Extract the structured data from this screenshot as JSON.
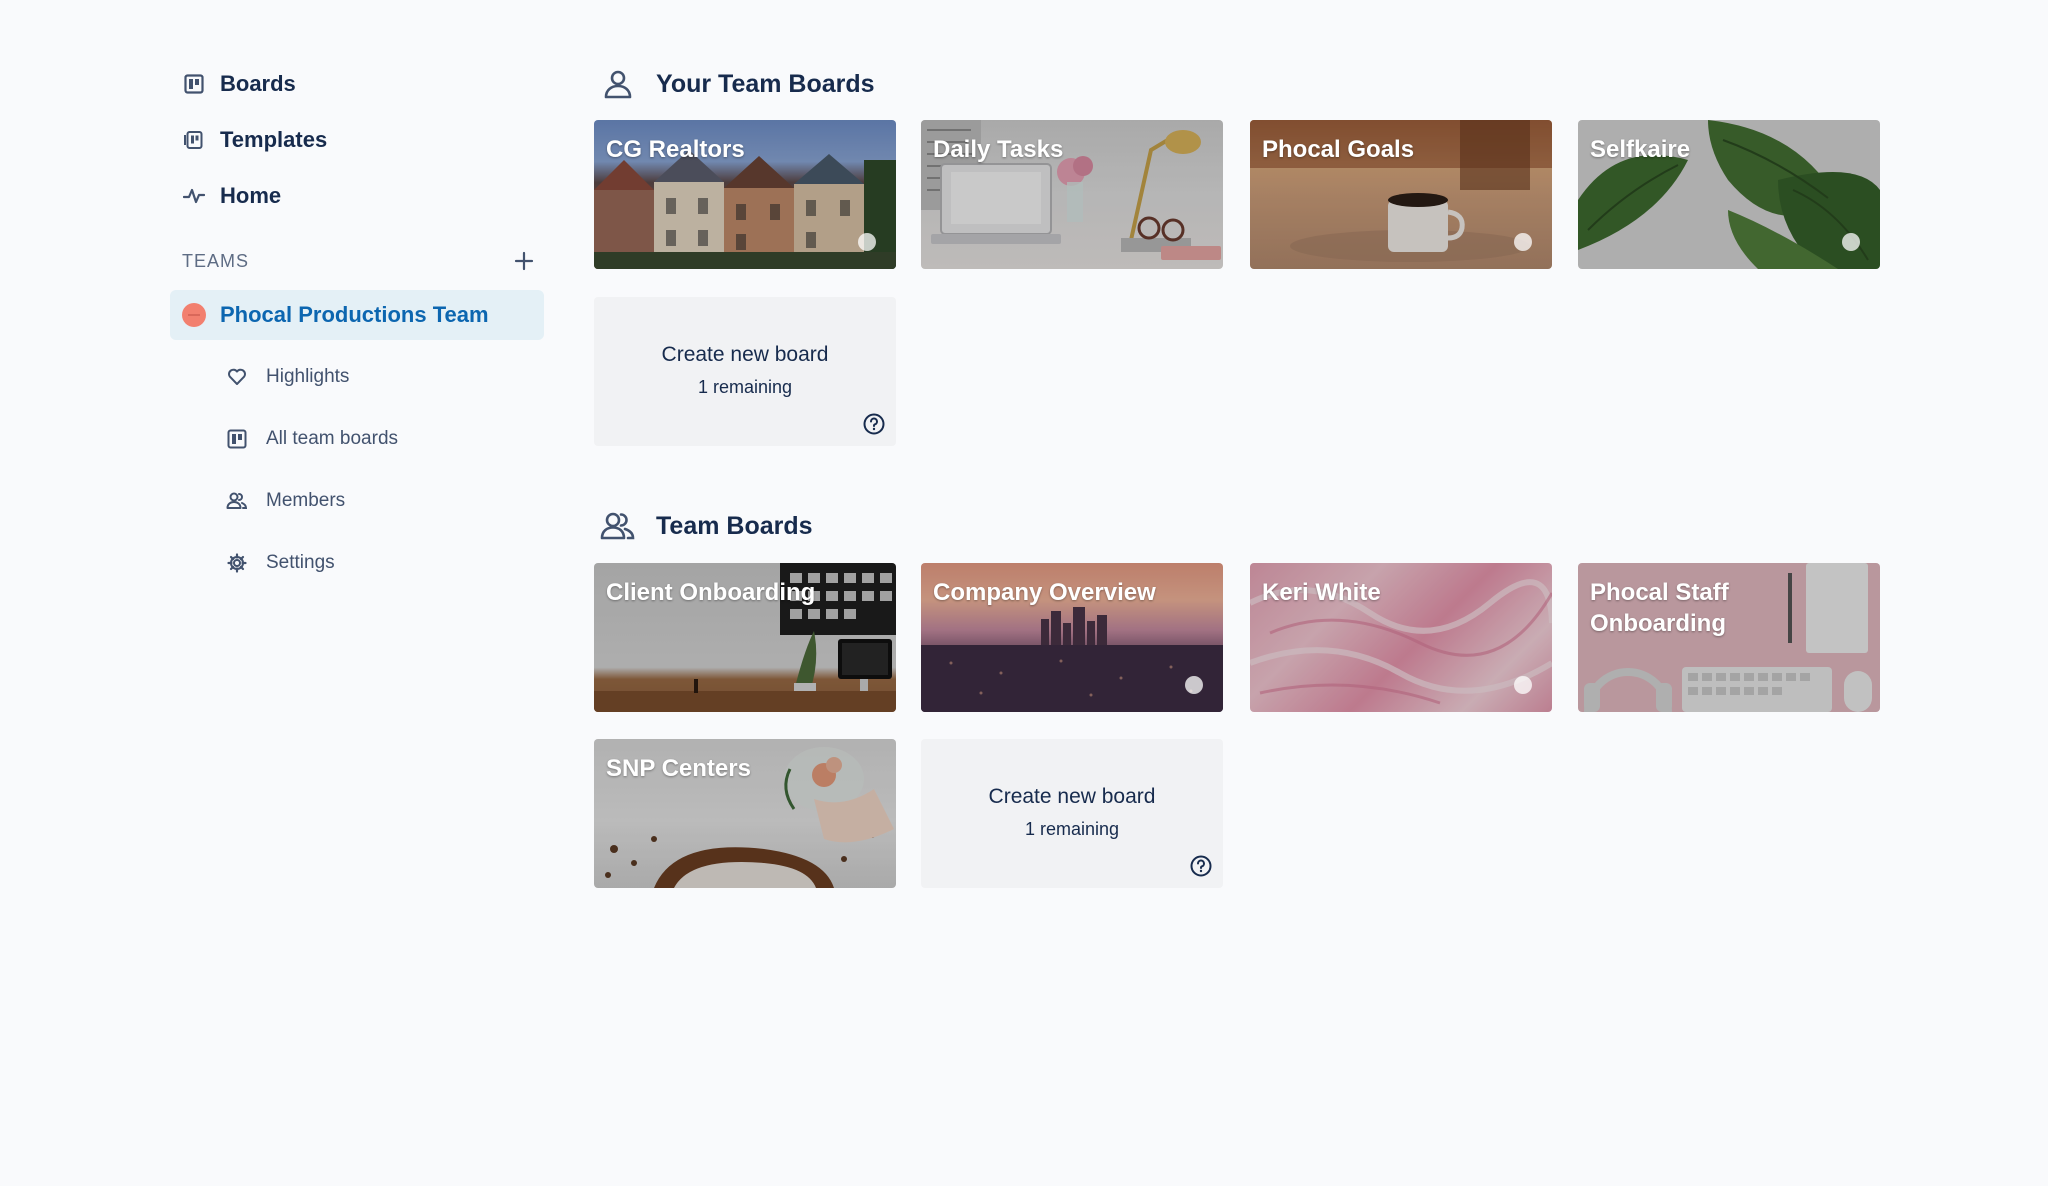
{
  "sidebar": {
    "nav": [
      {
        "label": "Boards",
        "icon": "board-icon"
      },
      {
        "label": "Templates",
        "icon": "templates-icon"
      },
      {
        "label": "Home",
        "icon": "activity-icon"
      }
    ],
    "teams_label": "TEAMS",
    "team": {
      "name": "Phocal Productions Team",
      "logo_color": "#f2806f"
    },
    "team_items": [
      {
        "label": "Highlights",
        "icon": "heart-icon"
      },
      {
        "label": "All team boards",
        "icon": "board-icon"
      },
      {
        "label": "Members",
        "icon": "members-icon"
      },
      {
        "label": "Settings",
        "icon": "gear-icon"
      }
    ]
  },
  "your_boards": {
    "title": "Your Team Boards",
    "boards": [
      {
        "title": "CG Realtors",
        "starred_dot": true
      },
      {
        "title": "Daily Tasks",
        "starred_dot": false
      },
      {
        "title": "Phocal Goals",
        "starred_dot": true
      },
      {
        "title": "Selfkaire",
        "starred_dot": true
      }
    ],
    "create": {
      "label": "Create new board",
      "remaining": "1 remaining"
    }
  },
  "team_boards": {
    "title": "Team Boards",
    "boards": [
      {
        "title": "Client Onboarding",
        "starred_dot": false
      },
      {
        "title": "Company Overview",
        "starred_dot": true
      },
      {
        "title": "Keri White",
        "starred_dot": true
      },
      {
        "title": "Phocal Staff Onboarding",
        "starred_dot": false
      },
      {
        "title": "SNP Centers",
        "starred_dot": false
      }
    ],
    "create": {
      "label": "Create new board",
      "remaining": "1 remaining"
    }
  },
  "colors": {
    "accent": "#0c66b0",
    "team_highlight": "#e4f0f6",
    "text": "#172b4d"
  }
}
